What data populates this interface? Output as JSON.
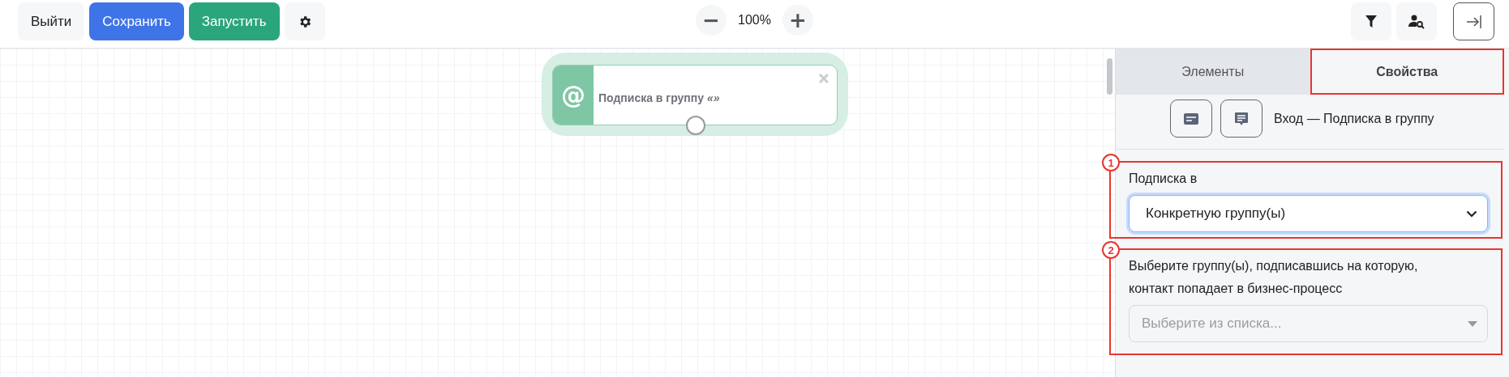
{
  "toolbar": {
    "buttons": [
      {
        "label": "Выйти",
        "kind": "plain"
      },
      {
        "label": "Сохранить",
        "kind": "primary"
      },
      {
        "label": "Запустить",
        "kind": "success"
      },
      {
        "kind": "settings"
      }
    ],
    "zoom": {
      "minus": "−",
      "value": "100%",
      "plus": "+"
    },
    "right_buttons": [
      {
        "kind": "filter"
      },
      {
        "kind": "user-search"
      },
      {
        "kind": "collapse"
      }
    ]
  },
  "canvas": {
    "node": {
      "title": "Подписка в группу *«»*",
      "icon": "@"
    }
  },
  "panel": {
    "tabs": [
      {
        "label": "Элементы",
        "selected": false,
        "highlighted": false
      },
      {
        "label": "Свойства",
        "selected": true,
        "highlighted": true
      }
    ],
    "header": "Вход — Подписка в группу",
    "fields": [
      {
        "marker": "1",
        "label": "Подписка в",
        "kind": "select",
        "value": "Конкретную группу(ы)",
        "focused": true
      },
      {
        "marker": "2",
        "label": "Выберите группу(ы), подписавшись на которую, контакт попадает в бизнес-процесс",
        "kind": "multiselect",
        "placeholder": "Выберите из списка...",
        "focused": false
      }
    ]
  }
}
